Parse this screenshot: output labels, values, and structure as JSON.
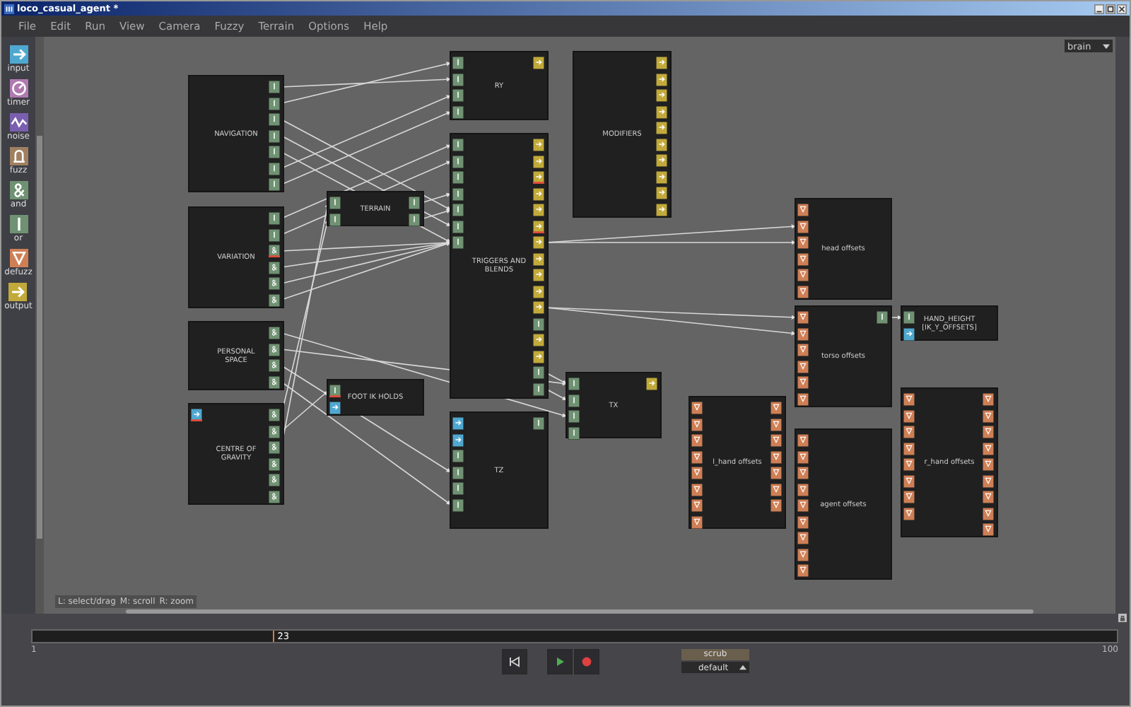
{
  "window": {
    "title": "loco_casual_agent *"
  },
  "menu": [
    "File",
    "Edit",
    "Run",
    "View",
    "Camera",
    "Fuzzy",
    "Terrain",
    "Options",
    "Help"
  ],
  "brain_selector": {
    "value": "brain"
  },
  "palette": [
    {
      "label": "input",
      "kind": "input"
    },
    {
      "label": "timer",
      "kind": "timer"
    },
    {
      "label": "noise",
      "kind": "noise"
    },
    {
      "label": "fuzz",
      "kind": "fuzz"
    },
    {
      "label": "and",
      "kind": "and"
    },
    {
      "label": "or",
      "kind": "or"
    },
    {
      "label": "defuzz",
      "kind": "defuzz"
    },
    {
      "label": "output",
      "kind": "output"
    }
  ],
  "nodes": [
    {
      "label": "NAVIGATION",
      "outputs": [
        {
          "kind": "or",
          "flagged": false
        },
        {
          "kind": "or",
          "flagged": false
        },
        {
          "kind": "or",
          "flagged": false
        },
        {
          "kind": "or",
          "flagged": false
        },
        {
          "kind": "or",
          "flagged": false
        },
        {
          "kind": "or",
          "flagged": false
        },
        {
          "kind": "or",
          "flagged": false
        }
      ]
    },
    {
      "label": "VARIATION",
      "outputs": [
        {
          "kind": "or",
          "flagged": false
        },
        {
          "kind": "or",
          "flagged": false
        },
        {
          "kind": "and",
          "flagged": true
        },
        {
          "kind": "and",
          "flagged": false
        },
        {
          "kind": "and",
          "flagged": false
        },
        {
          "kind": "and",
          "flagged": false
        }
      ]
    },
    {
      "label": "PERSONAL SPACE",
      "outputs": [
        {
          "kind": "and",
          "flagged": false
        },
        {
          "kind": "and",
          "flagged": false
        },
        {
          "kind": "and",
          "flagged": false
        },
        {
          "kind": "and",
          "flagged": false
        }
      ]
    },
    {
      "label": "CENTRE OF GRAVITY",
      "inputs": [
        {
          "kind": "input",
          "flagged": true
        }
      ],
      "outputs": [
        {
          "kind": "and",
          "flagged": false
        },
        {
          "kind": "and",
          "flagged": false
        },
        {
          "kind": "and",
          "flagged": false
        },
        {
          "kind": "and",
          "flagged": false
        },
        {
          "kind": "and",
          "flagged": false
        },
        {
          "kind": "and",
          "flagged": false
        }
      ]
    },
    {
      "label": "TERRAIN",
      "inputs": [
        {
          "kind": "or",
          "flagged": false
        },
        {
          "kind": "or",
          "flagged": false
        }
      ],
      "outputs": [
        {
          "kind": "or",
          "flagged": false
        },
        {
          "kind": "or",
          "flagged": false
        }
      ]
    },
    {
      "label": "FOOT IK HOLDS",
      "inputs": [
        {
          "kind": "or",
          "flagged": true
        },
        {
          "kind": "input",
          "flagged": false
        }
      ]
    },
    {
      "label": "RY",
      "inputs": [
        {
          "kind": "or",
          "flagged": false
        },
        {
          "kind": "or",
          "flagged": false
        },
        {
          "kind": "or",
          "flagged": false
        },
        {
          "kind": "or",
          "flagged": false
        }
      ],
      "outputs": [
        {
          "kind": "output",
          "flagged": false
        }
      ]
    },
    {
      "label": "TRIGGERS AND BLENDS",
      "inputs": [
        {
          "kind": "or",
          "flagged": false
        },
        {
          "kind": "or",
          "flagged": false
        },
        {
          "kind": "or",
          "flagged": false
        },
        {
          "kind": "or",
          "flagged": false
        },
        {
          "kind": "or",
          "flagged": false
        },
        {
          "kind": "or",
          "flagged": false
        },
        {
          "kind": "or",
          "flagged": false
        }
      ],
      "outputs": [
        {
          "kind": "output",
          "flagged": false
        },
        {
          "kind": "output",
          "flagged": false
        },
        {
          "kind": "output",
          "flagged": true
        },
        {
          "kind": "output",
          "flagged": false
        },
        {
          "kind": "output",
          "flagged": false
        },
        {
          "kind": "output",
          "flagged": true
        },
        {
          "kind": "output",
          "flagged": false
        },
        {
          "kind": "output",
          "flagged": false
        },
        {
          "kind": "output",
          "flagged": false
        },
        {
          "kind": "output",
          "flagged": false
        },
        {
          "kind": "output",
          "flagged": false
        },
        {
          "kind": "or",
          "flagged": false
        },
        {
          "kind": "output",
          "flagged": false
        },
        {
          "kind": "output",
          "flagged": false
        },
        {
          "kind": "or",
          "flagged": false
        },
        {
          "kind": "or",
          "flagged": false
        }
      ]
    },
    {
      "label": "TZ",
      "inputs": [
        {
          "kind": "input",
          "flagged": false
        },
        {
          "kind": "input",
          "flagged": false
        },
        {
          "kind": "or",
          "flagged": false
        },
        {
          "kind": "or",
          "flagged": false
        },
        {
          "kind": "or",
          "flagged": false
        },
        {
          "kind": "or",
          "flagged": false
        }
      ],
      "outputs": [
        {
          "kind": "or",
          "flagged": false
        }
      ]
    },
    {
      "label": "MODIFIERS",
      "outputs": [
        {
          "kind": "output",
          "flagged": false
        },
        {
          "kind": "output",
          "flagged": false
        },
        {
          "kind": "output",
          "flagged": false
        },
        {
          "kind": "output",
          "flagged": false
        },
        {
          "kind": "output",
          "flagged": false
        },
        {
          "kind": "output",
          "flagged": false
        },
        {
          "kind": "output",
          "flagged": false
        },
        {
          "kind": "output",
          "flagged": false
        },
        {
          "kind": "output",
          "flagged": false
        },
        {
          "kind": "output",
          "flagged": false
        }
      ]
    },
    {
      "label": "TX",
      "inputs": [
        {
          "kind": "or",
          "flagged": false
        },
        {
          "kind": "or",
          "flagged": false
        },
        {
          "kind": "or",
          "flagged": false
        },
        {
          "kind": "or",
          "flagged": false
        }
      ],
      "outputs": [
        {
          "kind": "output",
          "flagged": false
        }
      ]
    },
    {
      "label": "head offsets",
      "inputs": [
        {
          "kind": "defuzz",
          "flagged": false
        },
        {
          "kind": "defuzz",
          "flagged": false
        },
        {
          "kind": "defuzz",
          "flagged": false
        },
        {
          "kind": "defuzz",
          "flagged": false
        },
        {
          "kind": "defuzz",
          "flagged": false
        },
        {
          "kind": "defuzz",
          "flagged": false
        }
      ]
    },
    {
      "label": "torso offsets",
      "inputs": [
        {
          "kind": "defuzz",
          "flagged": false
        },
        {
          "kind": "defuzz",
          "flagged": false
        },
        {
          "kind": "defuzz",
          "flagged": false
        },
        {
          "kind": "defuzz",
          "flagged": false
        },
        {
          "kind": "defuzz",
          "flagged": false
        },
        {
          "kind": "defuzz",
          "flagged": false
        }
      ],
      "outputs": [
        {
          "kind": "or",
          "flagged": false
        }
      ]
    },
    {
      "label": "HAND_HEIGHT [IK_Y_OFFSETS]",
      "inputs": [
        {
          "kind": "or",
          "flagged": false
        },
        {
          "kind": "input",
          "flagged": false
        }
      ]
    },
    {
      "label": "l_hand offsets",
      "inputs": [
        {
          "kind": "defuzz",
          "flagged": false
        },
        {
          "kind": "defuzz",
          "flagged": false
        },
        {
          "kind": "defuzz",
          "flagged": false
        },
        {
          "kind": "defuzz",
          "flagged": false
        },
        {
          "kind": "defuzz",
          "flagged": false
        },
        {
          "kind": "defuzz",
          "flagged": false
        },
        {
          "kind": "defuzz",
          "flagged": false
        },
        {
          "kind": "defuzz",
          "flagged": false
        }
      ],
      "outputs": [
        {
          "kind": "defuzz",
          "flagged": false
        },
        {
          "kind": "defuzz",
          "flagged": false
        },
        {
          "kind": "defuzz",
          "flagged": false
        },
        {
          "kind": "defuzz",
          "flagged": false
        },
        {
          "kind": "defuzz",
          "flagged": false
        },
        {
          "kind": "defuzz",
          "flagged": false
        },
        {
          "kind": "defuzz",
          "flagged": false
        }
      ]
    },
    {
      "label": "agent offsets",
      "inputs": [
        {
          "kind": "defuzz",
          "flagged": false
        },
        {
          "kind": "defuzz",
          "flagged": false
        },
        {
          "kind": "defuzz",
          "flagged": false
        },
        {
          "kind": "defuzz",
          "flagged": false
        },
        {
          "kind": "defuzz",
          "flagged": false
        },
        {
          "kind": "defuzz",
          "flagged": false
        },
        {
          "kind": "defuzz",
          "flagged": false
        },
        {
          "kind": "defuzz",
          "flagged": false
        },
        {
          "kind": "defuzz",
          "flagged": false
        }
      ]
    },
    {
      "label": "r_hand offsets",
      "inputs": [
        {
          "kind": "defuzz",
          "flagged": false
        },
        {
          "kind": "defuzz",
          "flagged": false
        },
        {
          "kind": "defuzz",
          "flagged": false
        },
        {
          "kind": "defuzz",
          "flagged": false
        },
        {
          "kind": "defuzz",
          "flagged": false
        },
        {
          "kind": "defuzz",
          "flagged": false
        },
        {
          "kind": "defuzz",
          "flagged": false
        },
        {
          "kind": "defuzz",
          "flagged": false
        }
      ],
      "outputs": [
        {
          "kind": "defuzz",
          "flagged": false
        },
        {
          "kind": "defuzz",
          "flagged": false
        },
        {
          "kind": "defuzz",
          "flagged": false
        },
        {
          "kind": "defuzz",
          "flagged": false
        },
        {
          "kind": "defuzz",
          "flagged": false
        },
        {
          "kind": "defuzz",
          "flagged": false
        },
        {
          "kind": "defuzz",
          "flagged": false
        },
        {
          "kind": "defuzz",
          "flagged": false
        },
        {
          "kind": "defuzz",
          "flagged": false
        }
      ]
    }
  ],
  "hints": [
    "L: select/drag",
    "M: scroll",
    "R: zoom"
  ],
  "timeline": {
    "frame": "23",
    "level": 0.222,
    "start": "1",
    "end": "100"
  },
  "transport": {
    "scrub": "scrub",
    "mode": "default"
  }
}
